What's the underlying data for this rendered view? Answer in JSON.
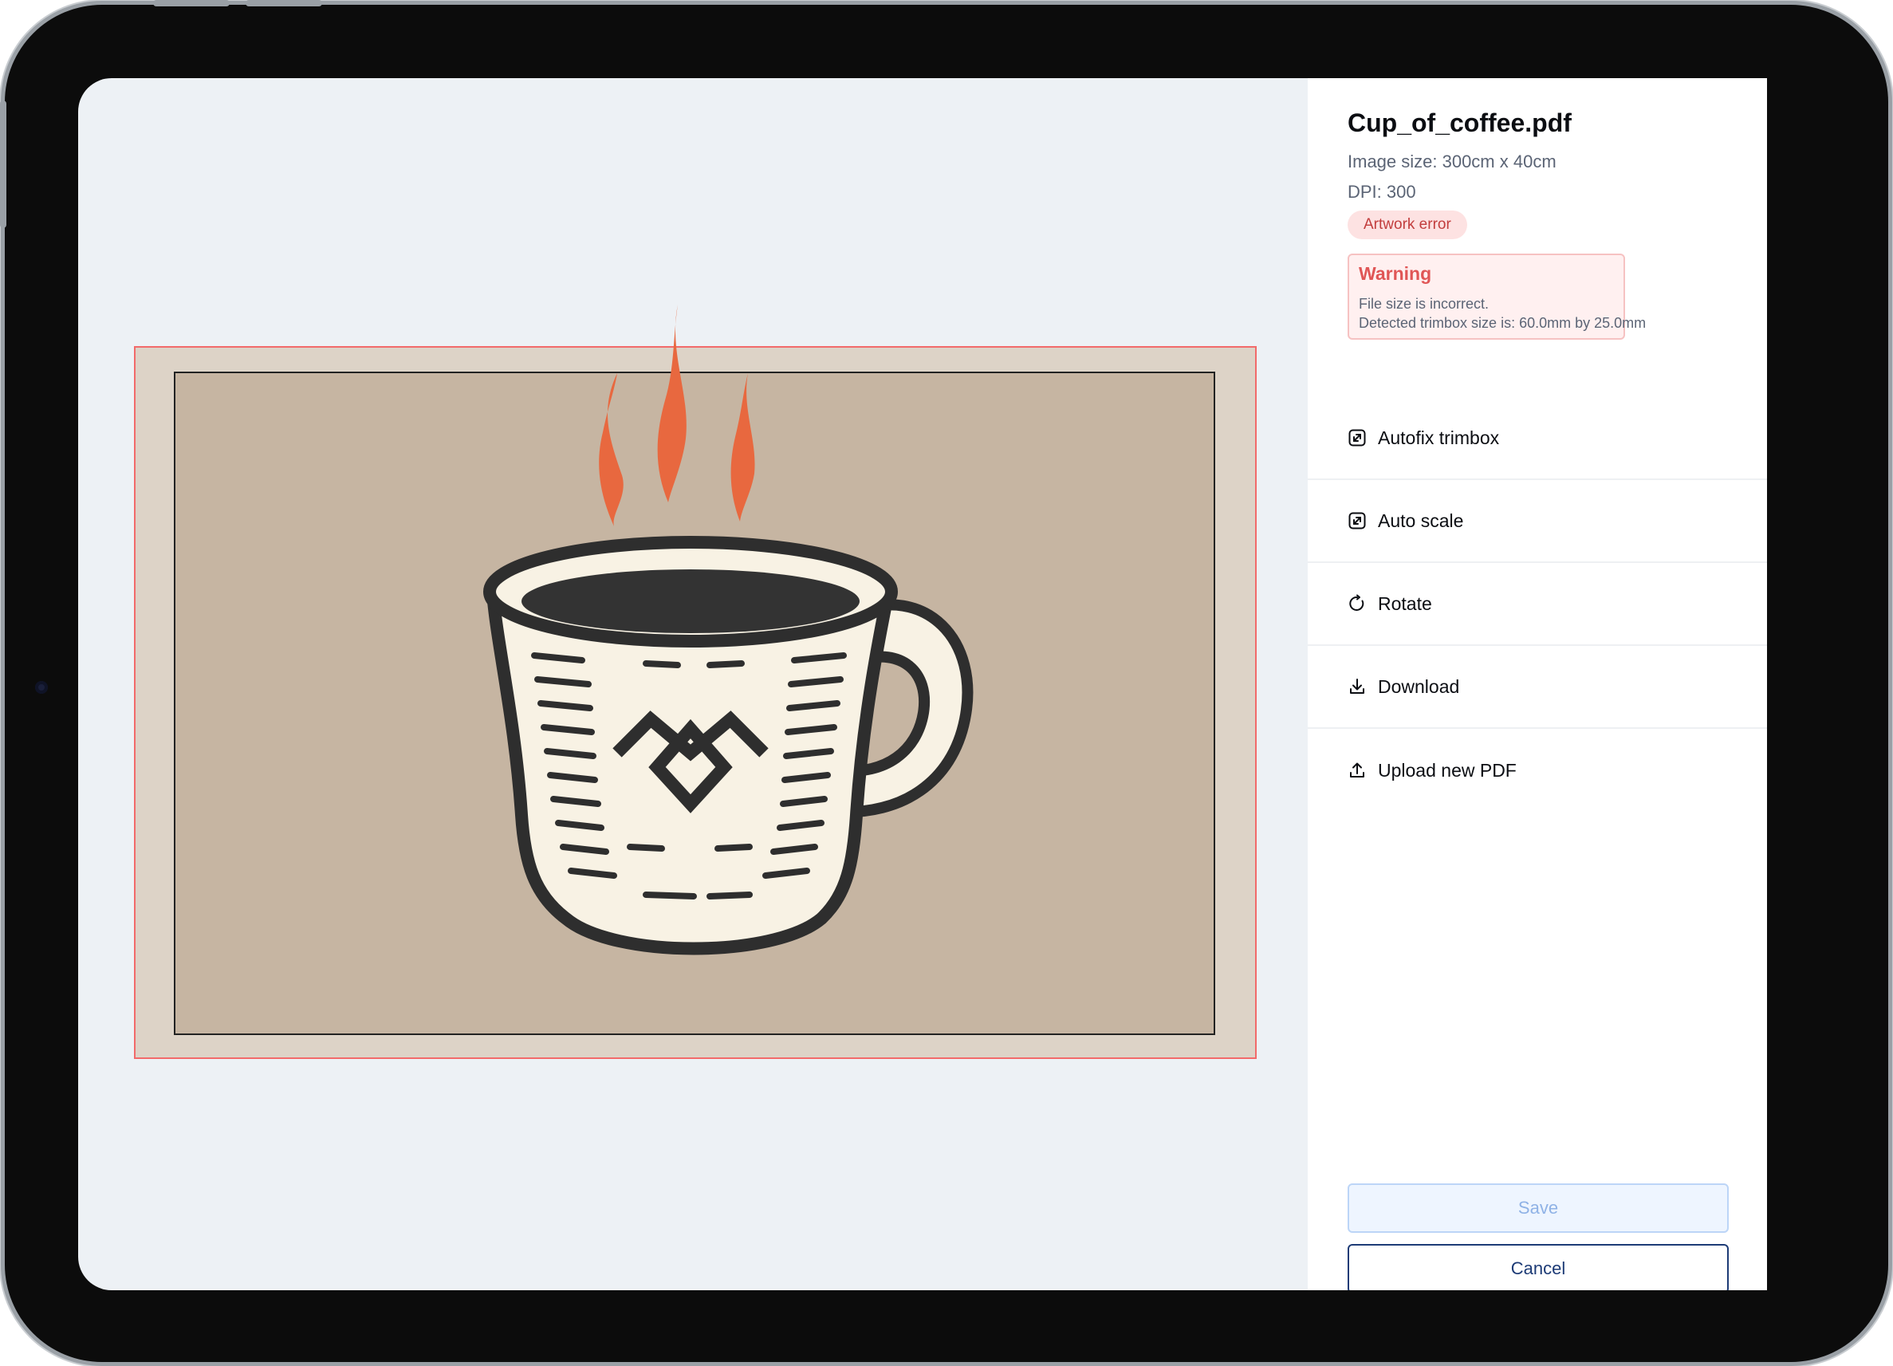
{
  "file": {
    "title": "Cup_of_coffee.pdf",
    "image_size": "Image size: 300cm x 40cm",
    "dpi": "DPI: 300",
    "badge": "Artwork error"
  },
  "warning": {
    "title": "Warning",
    "line1": "File size is incorrect.",
    "line2": "Detected trimbox size is: 60.0mm by 25.0mm"
  },
  "actions": [
    {
      "label": "Autofix trimbox",
      "icon": "resize-icon"
    },
    {
      "label": "Auto scale",
      "icon": "resize-icon"
    },
    {
      "label": "Rotate",
      "icon": "rotate-icon"
    },
    {
      "label": "Download",
      "icon": "download-icon"
    },
    {
      "label": "Upload new PDF",
      "icon": "upload-icon"
    }
  ],
  "buttons": {
    "save": "Save",
    "cancel": "Cancel"
  },
  "colors": {
    "bleed_border": "#f26a6a",
    "badge_bg": "#fde2e2",
    "badge_text": "#c23d3d",
    "accent": "#1d3b76"
  }
}
